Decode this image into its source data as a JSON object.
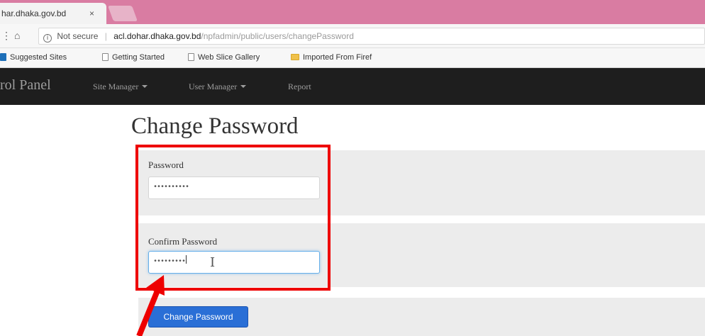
{
  "browser": {
    "tab_title": "har.dhaka.gov.bd",
    "tab_close": "×",
    "address": {
      "security_label": "Not secure",
      "url_host": "acl.dohar.dhaka.gov.bd",
      "url_path": "/npfadmin/public/users/changePassword"
    },
    "bookmarks": [
      "Suggested Sites",
      "Getting Started",
      "Web Slice Gallery",
      "Imported From Firef"
    ]
  },
  "navbar": {
    "brand": "rol Panel",
    "items": [
      {
        "label": "Site Manager",
        "dropdown": true
      },
      {
        "label": "User Manager",
        "dropdown": true
      },
      {
        "label": "Report",
        "dropdown": false
      }
    ]
  },
  "page": {
    "title": "Change Password",
    "password": {
      "label": "Password",
      "value": "••••••••••"
    },
    "confirm_password": {
      "label": "Confirm Password",
      "value": "•••••••••"
    },
    "submit_label": "Change Password"
  },
  "annotation": {
    "color": "#ee0000"
  }
}
